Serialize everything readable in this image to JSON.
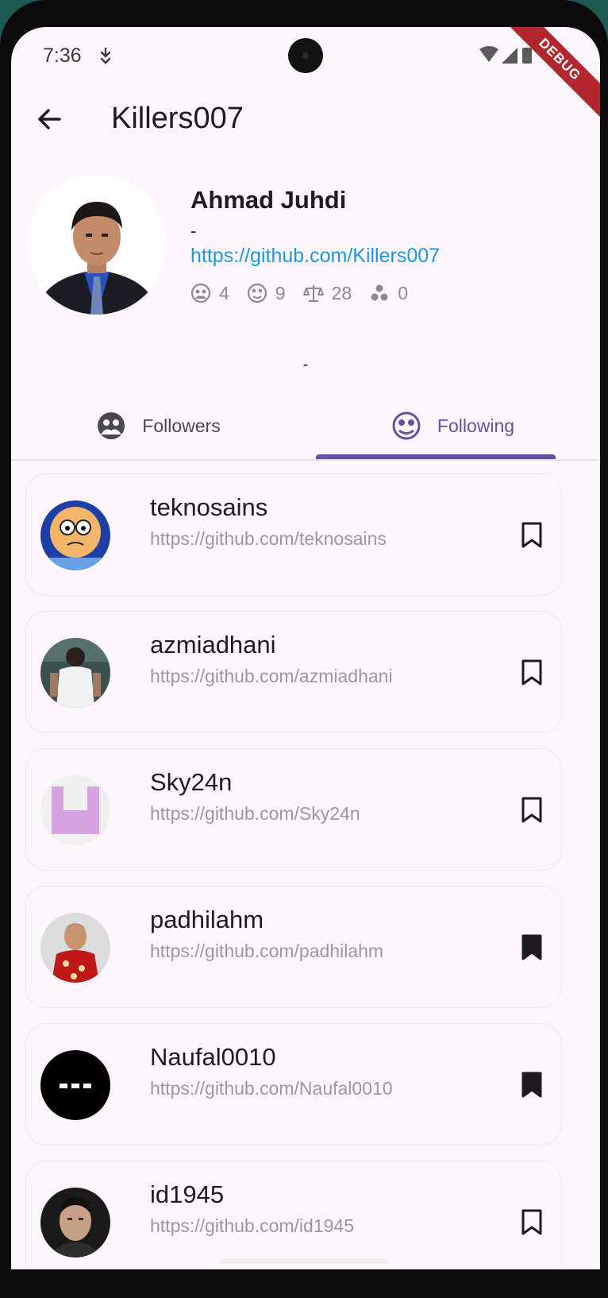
{
  "status_bar": {
    "time": "7:36",
    "debug_label": "DEBUG"
  },
  "app_bar": {
    "title": "Killers007"
  },
  "profile": {
    "name": "Ahmad Juhdi",
    "bio": "-",
    "url": "https://github.com/Killers007",
    "stats": {
      "followers": "4",
      "following": "9",
      "repos": "28",
      "gists": "0"
    },
    "location": "-"
  },
  "tabs": {
    "followers_label": "Followers",
    "following_label": "Following",
    "active": "Following"
  },
  "following_list": [
    {
      "username": "teknosains",
      "url": "https://github.com/teknosains",
      "bookmarked": false,
      "avatar": "cartoon-face"
    },
    {
      "username": "azmiadhani",
      "url": "https://github.com/azmiadhani",
      "bookmarked": false,
      "avatar": "photo-back"
    },
    {
      "username": "Sky24n",
      "url": "https://github.com/Sky24n",
      "bookmarked": false,
      "avatar": "identicon-purple"
    },
    {
      "username": "padhilahm",
      "url": "https://github.com/padhilahm",
      "bookmarked": true,
      "avatar": "photo-red-shirt"
    },
    {
      "username": "Naufal0010",
      "url": "https://github.com/Naufal0010",
      "bookmarked": true,
      "avatar": "black-dots"
    },
    {
      "username": "id1945",
      "url": "https://github.com/id1945",
      "bookmarked": false,
      "avatar": "photo-face"
    }
  ],
  "colors": {
    "accent": "#6750a4",
    "link": "#1b98e0",
    "background": "#fdf7fd"
  }
}
